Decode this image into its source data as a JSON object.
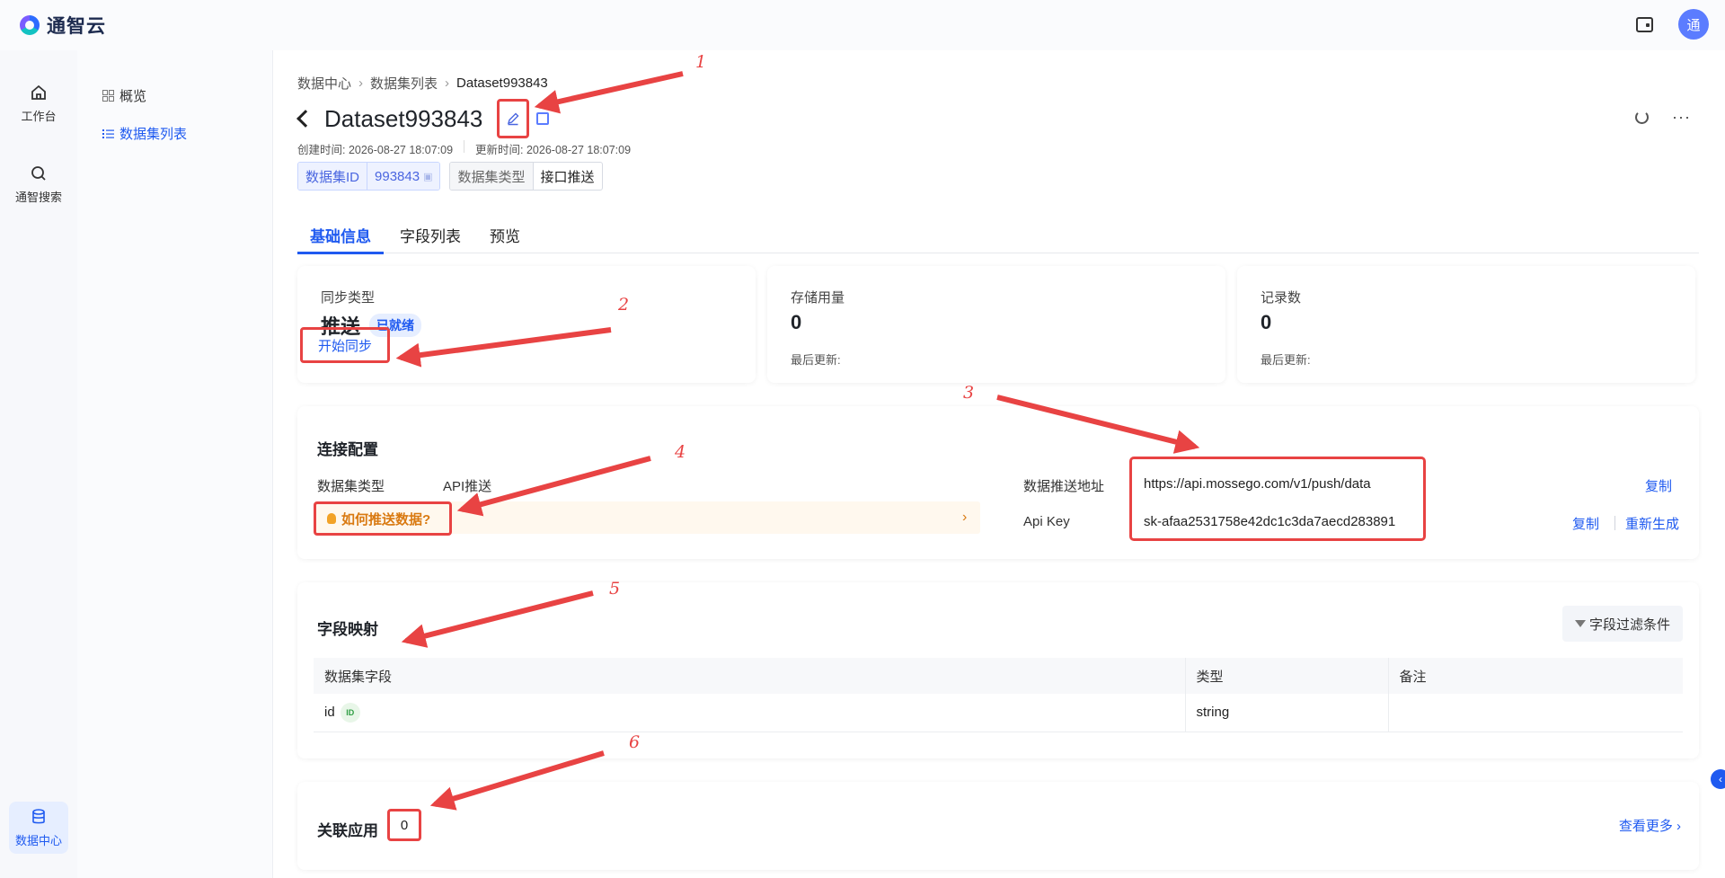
{
  "app": {
    "name": "通智云",
    "avatar_text": "通"
  },
  "rail": [
    {
      "label": "工作台",
      "icon": "home-icon"
    },
    {
      "label": "通智搜索",
      "icon": "search-icon"
    },
    {
      "label": "数据中心",
      "icon": "database-icon"
    }
  ],
  "subnav": [
    {
      "label": "概览",
      "icon": "grid-icon"
    },
    {
      "label": "数据集列表",
      "icon": "list-icon"
    }
  ],
  "breadcrumb": [
    "数据中心",
    "数据集列表",
    "Dataset993843"
  ],
  "page": {
    "title": "Dataset993843",
    "created": "创建时间: 2026-08-27 18:07:09",
    "updated": "更新时间: 2026-08-27 18:07:09"
  },
  "tags": {
    "id_key": "数据集ID",
    "id_val": "993843",
    "type_key": "数据集类型",
    "type_val": "接口推送"
  },
  "tabs": [
    "基础信息",
    "字段列表",
    "预览"
  ],
  "stats": {
    "sync_label": "同步类型",
    "sync_value": "推送",
    "sync_status": "已就绪",
    "sync_button": "开始同步",
    "storage_label": "存储用量",
    "storage_value": "0",
    "storage_sub": "最后更新:",
    "records_label": "记录数",
    "records_value": "0",
    "records_sub": "最后更新:"
  },
  "connection": {
    "title": "连接配置",
    "type_label": "数据集类型",
    "type_value": "API推送",
    "howto": "如何推送数据?",
    "url_label": "数据推送地址",
    "url_value": "https://api.mossego.com/v1/push/data",
    "key_label": "Api Key",
    "key_value": "sk-afaa2531758e42dc1c3da7aecd283891",
    "copy": "复制",
    "regenerate": "重新生成"
  },
  "mapping": {
    "title": "字段映射",
    "filter": "字段过滤条件",
    "columns": [
      "数据集字段",
      "类型",
      "备注"
    ],
    "rows": [
      {
        "field": "id",
        "badge": "ID",
        "type": "string",
        "note": ""
      }
    ]
  },
  "related": {
    "title": "关联应用",
    "count": "0",
    "see_more": "查看更多"
  },
  "annotations": [
    "1",
    "2",
    "3",
    "4",
    "5",
    "6"
  ],
  "colors": {
    "accent": "#1f5af0",
    "annotation": "#e84343",
    "warning": "#d97a12"
  }
}
